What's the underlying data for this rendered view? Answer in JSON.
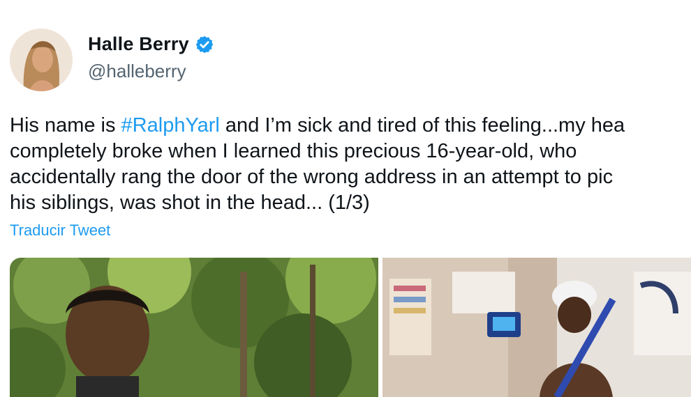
{
  "author": {
    "display_name": "Halle Berry",
    "handle": "@halleberry",
    "verified_icon": "verified-badge-icon"
  },
  "tweet": {
    "lines": [
      {
        "before": "His name is ",
        "hashtag": "#RalphYarl",
        "after": " and I’m sick and tired of this feeling...my hea"
      },
      {
        "text": "completely broke when I learned this precious 16-year-old, who"
      },
      {
        "text": "accidentally rang the door of the wrong address in an attempt to pic"
      },
      {
        "text": "his siblings, was shot in the head... (1/3)"
      }
    ],
    "translate_label": "Traducir Tweet"
  },
  "colors": {
    "accent": "#1d9bf0",
    "text": "#0f1419",
    "secondary": "#536471"
  }
}
